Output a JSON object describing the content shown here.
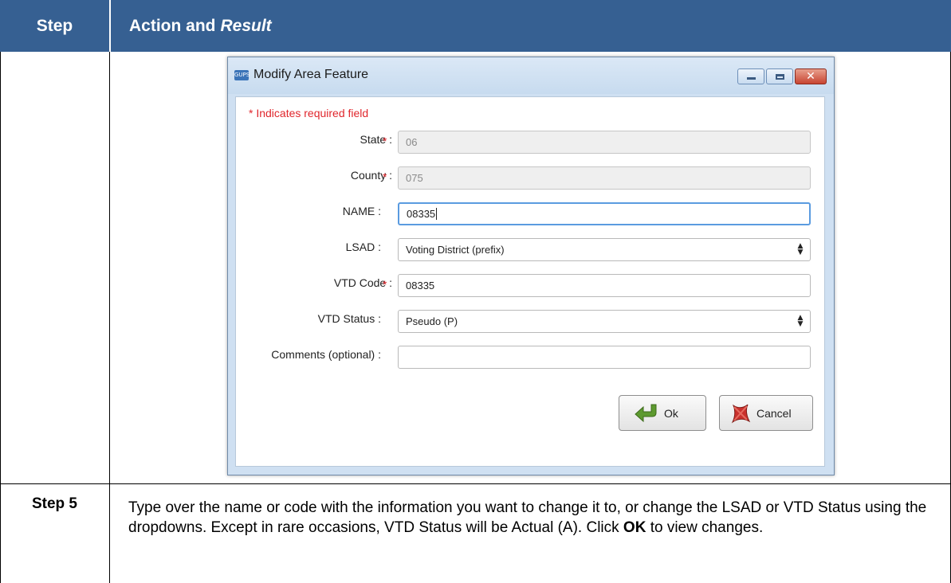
{
  "table": {
    "header_step": "Step",
    "header_action": "Action and",
    "header_result": "Result",
    "row_step": "Step 5",
    "row_text_1": "Type over the name or code with the information you want to change it to, or change the LSAD or VTD Status using the dropdowns. Except in rare occasions, VTD Status will be Actual (A). Click ",
    "row_text_bold": "OK",
    "row_text_2": " to view changes."
  },
  "dialog": {
    "icon_label": "GUPS",
    "title": "Modify Area Feature",
    "required_note": "* Indicates required field",
    "required_marker": "*",
    "fields": {
      "state": {
        "label": "State :",
        "value": "06"
      },
      "county": {
        "label": "County :",
        "value": "075"
      },
      "name": {
        "label": "NAME :",
        "value": "08335"
      },
      "lsad": {
        "label": "LSAD :",
        "value": "Voting District (prefix)"
      },
      "vtd_code": {
        "label": "VTD Code :",
        "value": "08335"
      },
      "vtd_status": {
        "label": "VTD Status :",
        "value": "Pseudo (P)"
      },
      "comments": {
        "label": "Comments (optional) :",
        "value": ""
      }
    },
    "ok_label": "Ok",
    "cancel_label": "Cancel"
  },
  "colors": {
    "header_bg": "#366092",
    "required": "#e0262c",
    "dialog_frame": "#cfe0f2"
  }
}
